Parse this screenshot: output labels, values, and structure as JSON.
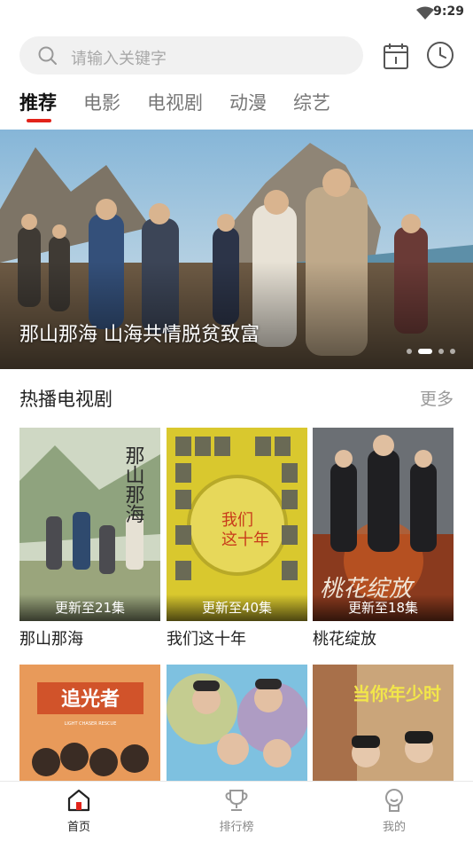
{
  "status_bar": {
    "time": "9:29"
  },
  "search": {
    "placeholder": "请输入关键字"
  },
  "tabs": [
    {
      "label": "推荐",
      "active": true
    },
    {
      "label": "电影"
    },
    {
      "label": "电视剧"
    },
    {
      "label": "动漫"
    },
    {
      "label": "综艺"
    }
  ],
  "banner": {
    "title": "那山那海 山海共情脱贫致富",
    "slide_count": 4,
    "active_slide": 1
  },
  "section": {
    "title": "热播电视剧",
    "more_label": "更多"
  },
  "dramas": [
    {
      "title": "那山那海",
      "badge": "更新至21集",
      "poster_text": "那山那海"
    },
    {
      "title": "我们这十年",
      "badge": "更新至40集",
      "poster_text": "我们这十年"
    },
    {
      "title": "桃花绽放",
      "badge": "更新至18集",
      "poster_text": "桃花绽放"
    }
  ],
  "dramas_row2": [
    {
      "poster_text": "追光者",
      "poster_subtext": "LIGHT CHASER RESCUE"
    },
    {
      "poster_text": ""
    },
    {
      "poster_text": "当你年少时"
    }
  ],
  "bottom_nav": [
    {
      "label": "首页",
      "active": true
    },
    {
      "label": "排行榜"
    },
    {
      "label": "我的"
    }
  ],
  "colors": {
    "accent": "#e2231a",
    "text": "#222222",
    "muted": "#999999"
  }
}
